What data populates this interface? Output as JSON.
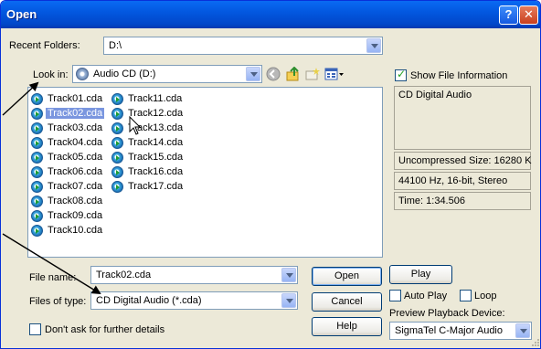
{
  "window": {
    "title": "Open",
    "help_glyph": "?",
    "close_glyph": "✕"
  },
  "recent": {
    "label": "Recent Folders:",
    "value": "D:\\"
  },
  "lookin": {
    "label": "Look in:",
    "value": "Audio CD (D:)"
  },
  "files": {
    "col1": [
      "Track01.cda",
      "Track02.cda",
      "Track03.cda",
      "Track04.cda",
      "Track05.cda",
      "Track06.cda",
      "Track07.cda",
      "Track08.cda",
      "Track09.cda",
      "Track10.cda"
    ],
    "col2": [
      "Track11.cda",
      "Track12.cda",
      "Track13.cda",
      "Track14.cda",
      "Track15.cda",
      "Track16.cda",
      "Track17.cda"
    ],
    "selected": "Track02.cda"
  },
  "filename": {
    "label": "File name:",
    "value": "Track02.cda"
  },
  "filetype": {
    "label": "Files of type:",
    "value": "CD Digital Audio (*.cda)"
  },
  "dont_ask": {
    "label": "Don't ask for further details",
    "checked": false
  },
  "buttons": {
    "open": "Open",
    "cancel": "Cancel",
    "help": "Help",
    "play": "Play"
  },
  "info": {
    "show_label": "Show File Information",
    "show_checked": true,
    "format": "CD Digital Audio",
    "uncompressed": "Uncompressed Size: 16280 K",
    "rate": "44100 Hz, 16-bit, Stereo",
    "time": "Time:   1:34.506"
  },
  "playback": {
    "auto_play": "Auto Play",
    "loop": "Loop",
    "device_label": "Preview Playback Device:",
    "device": "SigmaTel C-Major Audio"
  },
  "colors": {
    "title_bar": "#0358e0",
    "selection": "#7a96df",
    "dialog_bg": "#ece9d8"
  }
}
